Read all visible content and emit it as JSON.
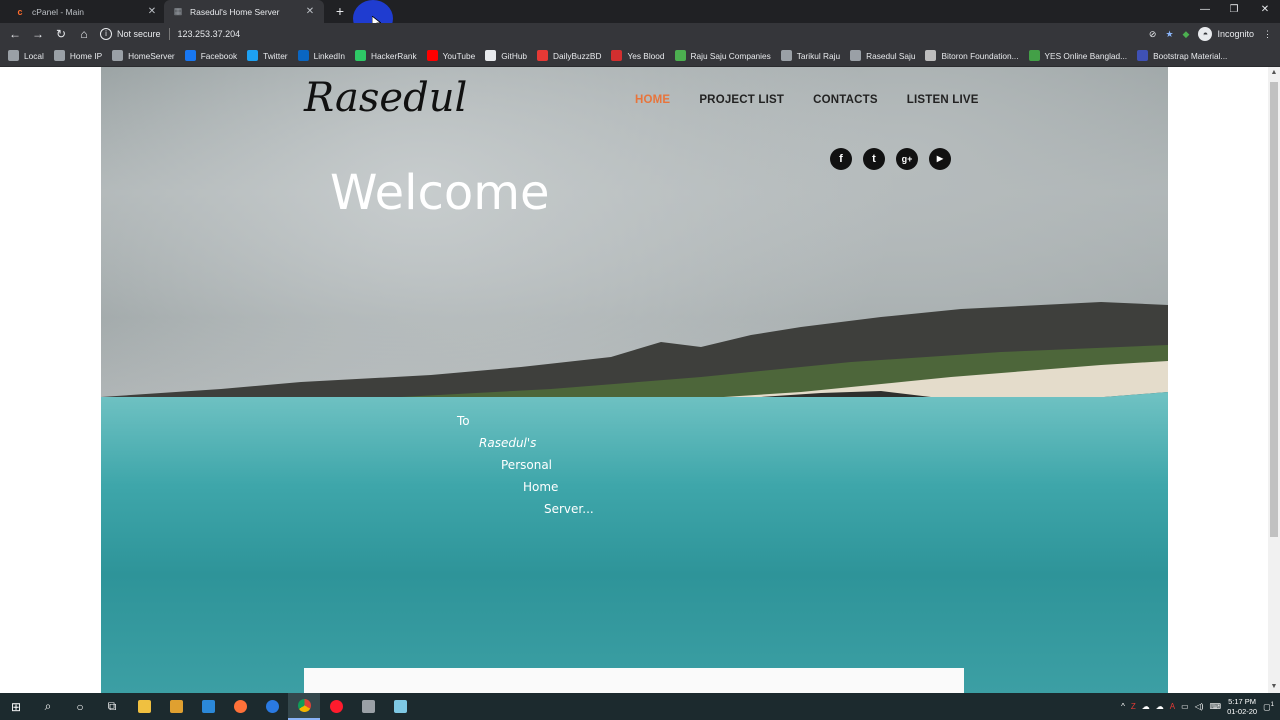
{
  "tabs": [
    {
      "title": "cPanel - Main",
      "active": false,
      "favicon": "cpanel-icon"
    },
    {
      "title": "Rasedul's Home Server",
      "active": true,
      "favicon": "server-icon"
    }
  ],
  "toolbar": {
    "security_label": "Not secure",
    "url": "123.253.37.204",
    "profile_label": "Incognito"
  },
  "bookmarks": [
    {
      "label": "Local",
      "icon": "server-icon",
      "color": "#9aa0a6"
    },
    {
      "label": "Home IP",
      "icon": "server-icon",
      "color": "#9aa0a6"
    },
    {
      "label": "HomeServer",
      "icon": "server-icon",
      "color": "#9aa0a6"
    },
    {
      "label": "Facebook",
      "icon": "facebook-icon",
      "color": "#1877f2"
    },
    {
      "label": "Twitter",
      "icon": "twitter-icon",
      "color": "#1da1f2"
    },
    {
      "label": "LinkedIn",
      "icon": "linkedin-icon",
      "color": "#0a66c2"
    },
    {
      "label": "HackerRank",
      "icon": "hackerrank-icon",
      "color": "#2ec866"
    },
    {
      "label": "YouTube",
      "icon": "youtube-icon",
      "color": "#ff0000"
    },
    {
      "label": "GitHub",
      "icon": "github-icon",
      "color": "#e8eaed"
    },
    {
      "label": "DailyBuzzBD",
      "icon": "dailybuzz-icon",
      "color": "#e53935"
    },
    {
      "label": "Yes Blood",
      "icon": "blood-drop-icon",
      "color": "#d32f2f"
    },
    {
      "label": "Raju Saju Companies",
      "icon": "company-icon",
      "color": "#4caf50"
    },
    {
      "label": "Tarikul Raju",
      "icon": "profile-icon",
      "color": "#9aa0a6"
    },
    {
      "label": "Rasedul Saju",
      "icon": "server-icon",
      "color": "#9aa0a6"
    },
    {
      "label": "Bitoron Foundation...",
      "icon": "page-icon",
      "color": "#bdbdbd"
    },
    {
      "label": "YES Online Banglad...",
      "icon": "check-icon",
      "color": "#43a047"
    },
    {
      "label": "Bootstrap Material...",
      "icon": "mdb-icon",
      "color": "#3f51b5"
    }
  ],
  "site": {
    "logo": "Rasedul",
    "nav": [
      {
        "label": "HOME",
        "active": true
      },
      {
        "label": "PROJECT LIST",
        "active": false
      },
      {
        "label": "CONTACTS",
        "active": false
      },
      {
        "label": "LISTEN LIVE",
        "active": false
      }
    ],
    "social": [
      {
        "name": "facebook-icon",
        "glyph": "f"
      },
      {
        "name": "twitter-icon",
        "glyph": "t"
      },
      {
        "name": "google-plus-icon",
        "glyph": "g+"
      },
      {
        "name": "youtube-icon",
        "glyph": "▶"
      }
    ],
    "welcome": "Welcome",
    "subtitle_words": [
      "To",
      "Rasedul's",
      "Personal",
      "Home",
      "Server..."
    ],
    "accent_color": "#e8743b"
  },
  "taskbar": {
    "time": "5:17 PM",
    "date": "01-02-20",
    "notification_count": "1"
  }
}
